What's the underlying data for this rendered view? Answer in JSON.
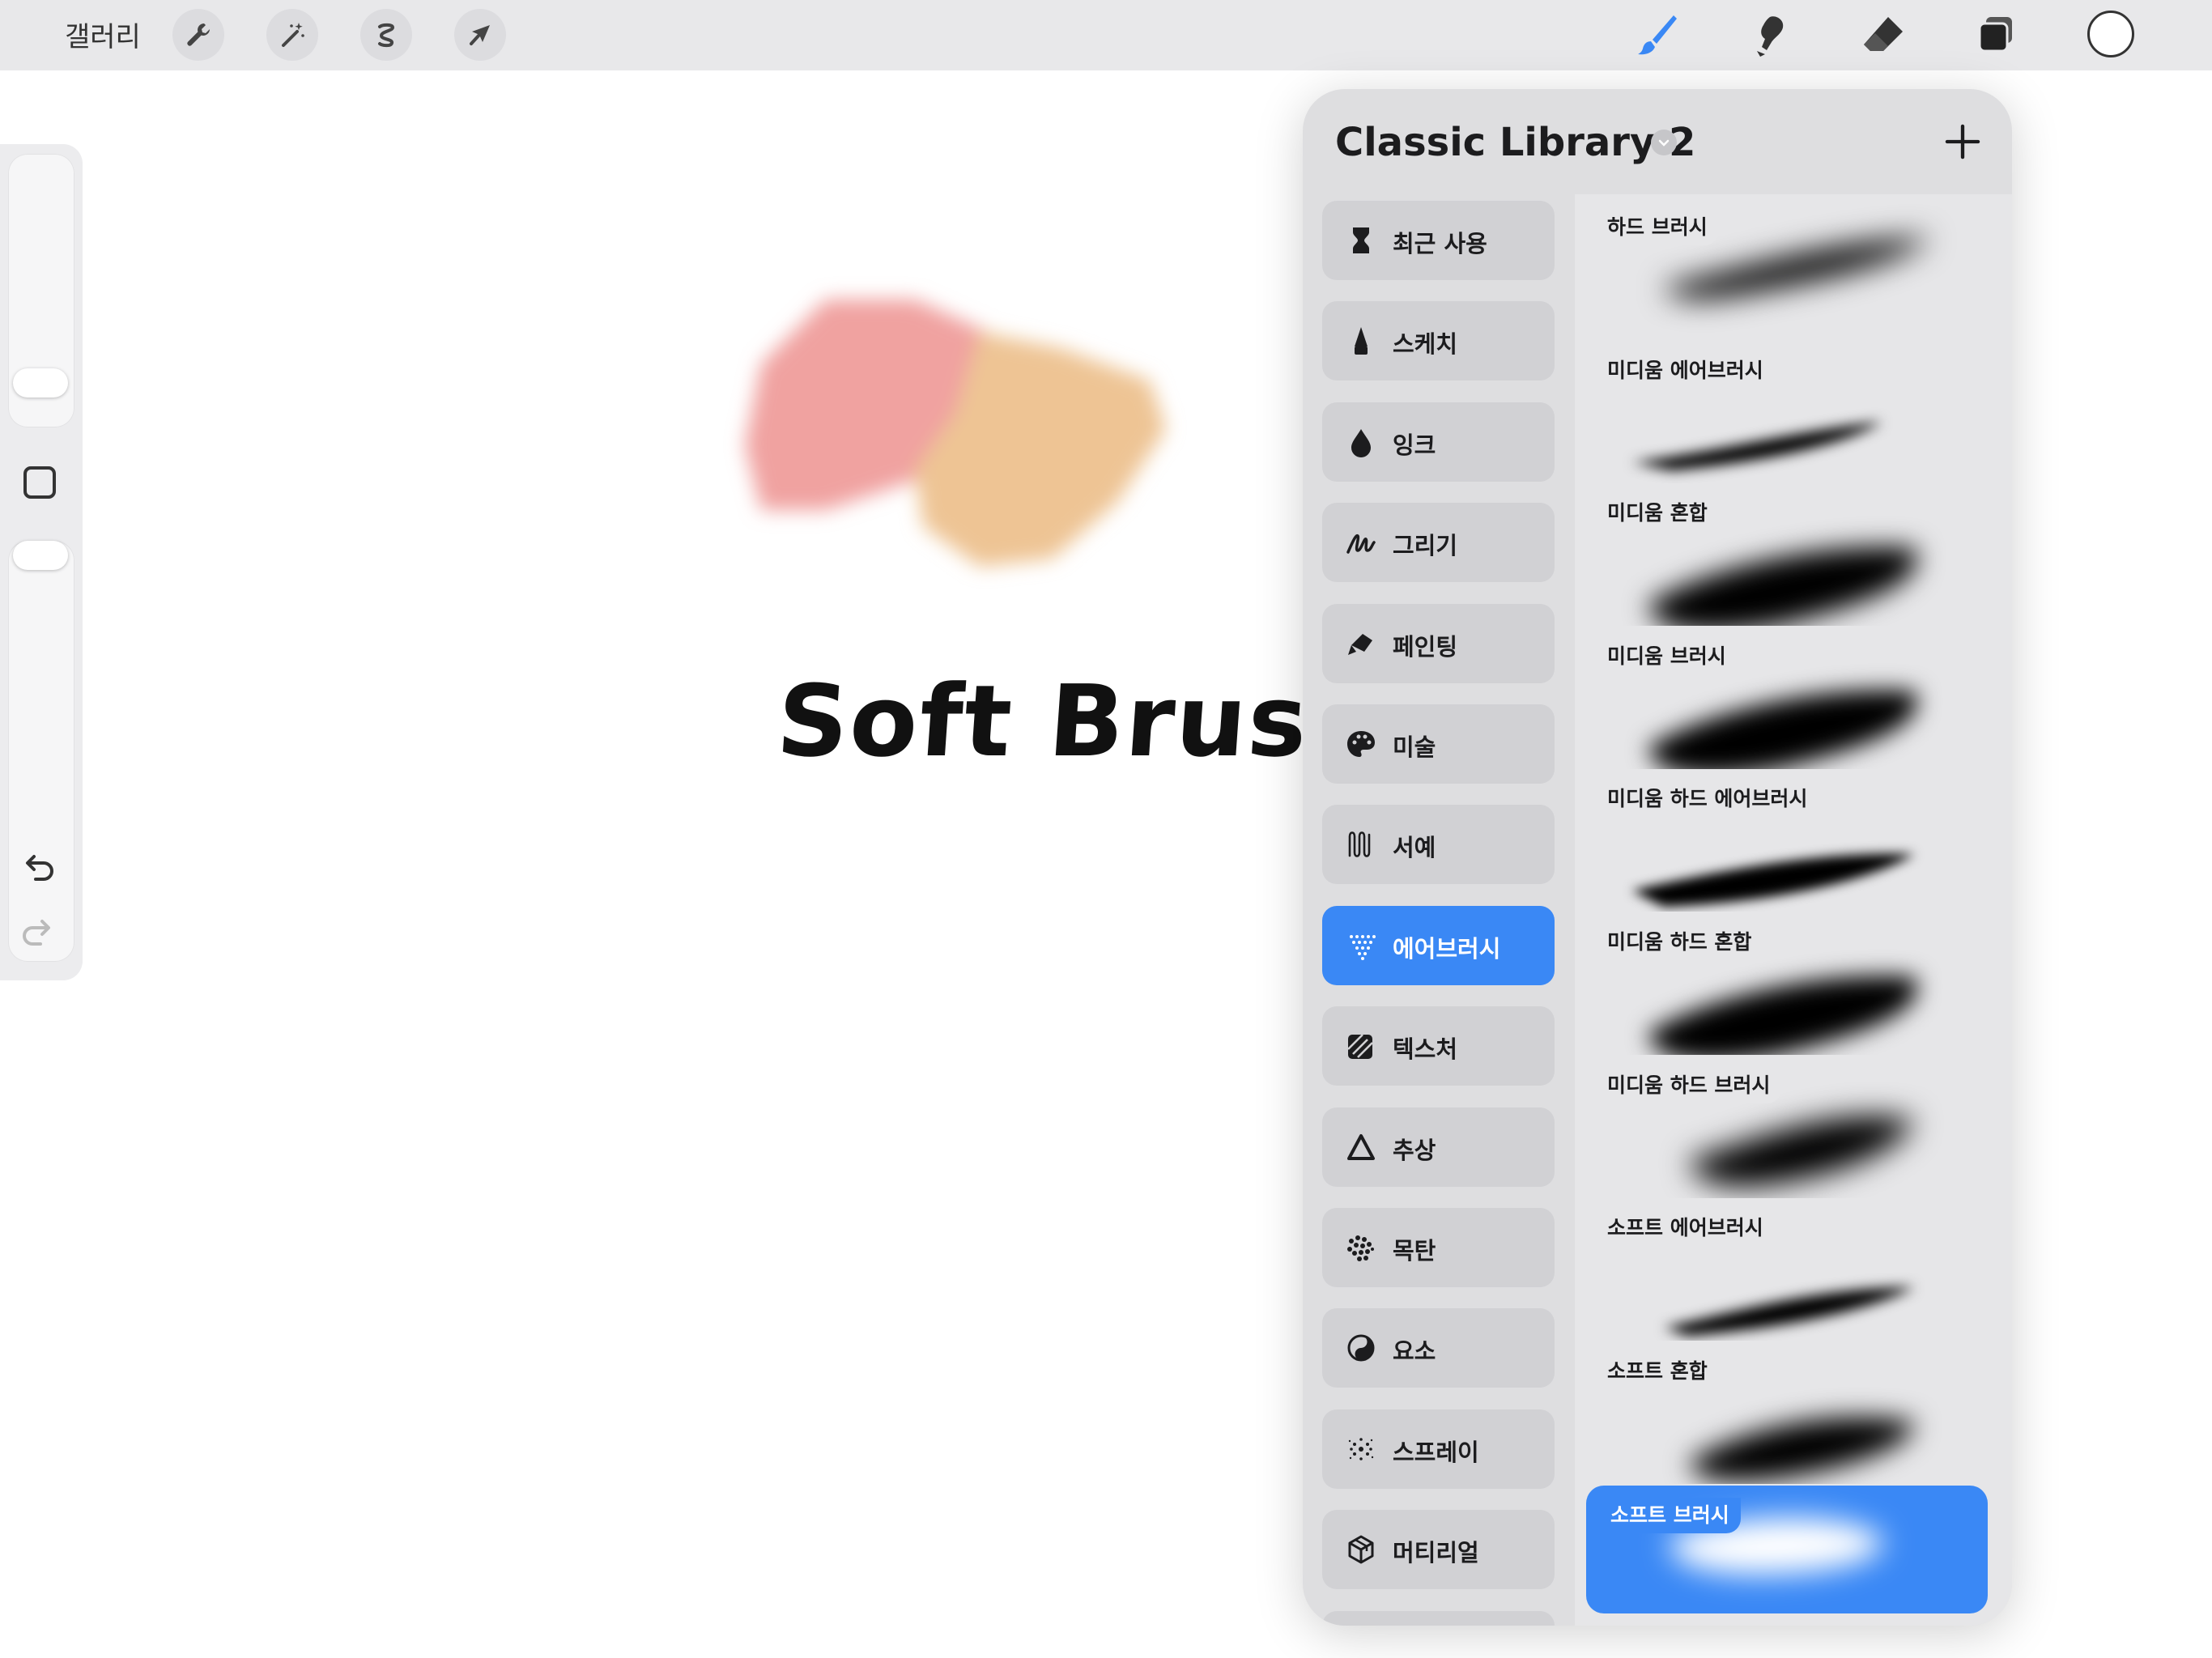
{
  "topbar": {
    "gallery_label": "갤러리",
    "left_tools": [
      "wrench-icon",
      "magic-wand-icon",
      "selection-icon",
      "transform-arrow-icon"
    ],
    "right_tools": [
      "brush-icon",
      "smudge-icon",
      "eraser-icon",
      "layers-icon"
    ],
    "active_tool": "brush-icon",
    "active_color": "#3a88f5",
    "current_color": "#ffffff"
  },
  "canvas": {
    "text": "Soft Brush",
    "swatch_colors": [
      "#f0a2a0",
      "#eec494"
    ]
  },
  "panel": {
    "title": "Classic Library 2",
    "add_symbol": "+",
    "sets": [
      {
        "label": "최근 사용",
        "icon": "hourglass-icon",
        "active": false
      },
      {
        "label": "스케치",
        "icon": "pencil-tip-icon",
        "active": false
      },
      {
        "label": "잉크",
        "icon": "ink-drop-icon",
        "active": false
      },
      {
        "label": "그리기",
        "icon": "drawing-scribble-icon",
        "active": false
      },
      {
        "label": "페인팅",
        "icon": "paint-brush-icon",
        "active": false
      },
      {
        "label": "미술",
        "icon": "palette-icon",
        "active": false
      },
      {
        "label": "서예",
        "icon": "calligraphy-icon",
        "active": false
      },
      {
        "label": "에어브러시",
        "icon": "airbrush-icon",
        "active": true
      },
      {
        "label": "텍스처",
        "icon": "texture-icon",
        "active": false
      },
      {
        "label": "추상",
        "icon": "abstract-triangle-icon",
        "active": false
      },
      {
        "label": "목탄",
        "icon": "charcoal-icon",
        "active": false
      },
      {
        "label": "요소",
        "icon": "elements-yin-yang-icon",
        "active": false
      },
      {
        "label": "스프레이",
        "icon": "spray-icon",
        "active": false
      },
      {
        "label": "머티리얼",
        "icon": "material-cube-icon",
        "active": false
      }
    ],
    "brushes": [
      {
        "label": "하드 브러시",
        "active": false
      },
      {
        "label": "미디움 에어브러시",
        "active": false
      },
      {
        "label": "미디움 혼합",
        "active": false
      },
      {
        "label": "미디움 브러시",
        "active": false
      },
      {
        "label": "미디움 하드 에어브러시",
        "active": false
      },
      {
        "label": "미디움 하드 혼합",
        "active": false
      },
      {
        "label": "미디움 하드 브러시",
        "active": false
      },
      {
        "label": "소프트 에어브러시",
        "active": false
      },
      {
        "label": "소프트 혼합",
        "active": false
      },
      {
        "label": "소프트 브러시",
        "active": true
      }
    ]
  }
}
